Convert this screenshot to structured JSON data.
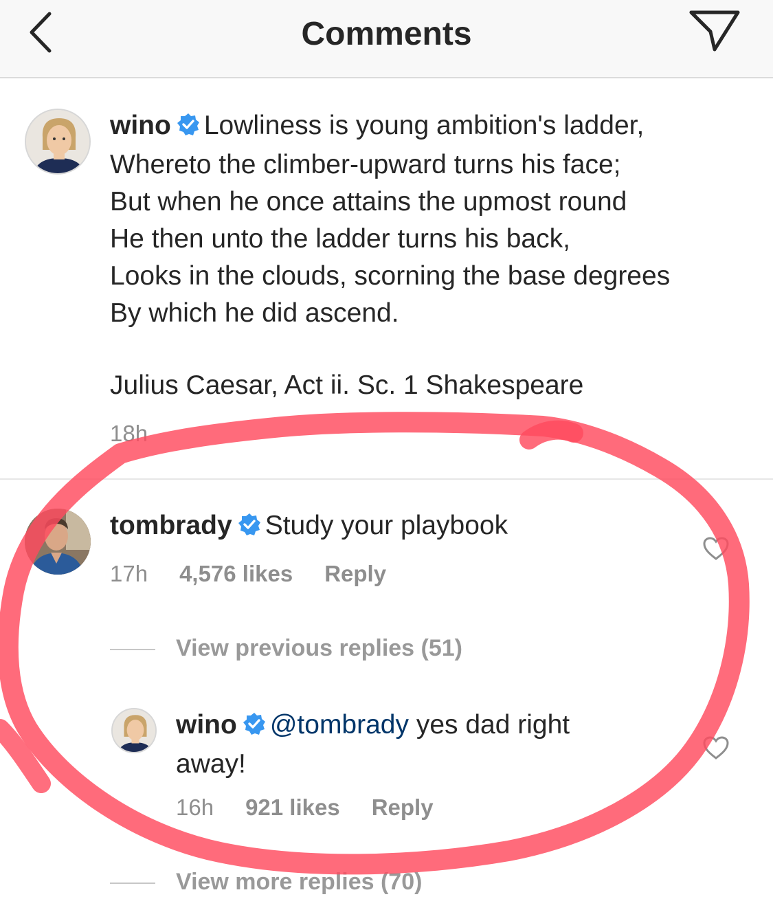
{
  "header": {
    "title": "Comments"
  },
  "caption": {
    "username": "wino",
    "lines": [
      "Lowliness is young ambition's ladder,",
      "Whereto the climber-upward turns his face;",
      "But when he once attains the upmost round",
      "He then unto the ladder turns his back,",
      "Looks in the clouds, scorning the base degrees",
      "By which he did ascend."
    ],
    "attribution": "Julius Caesar, Act ii. Sc. 1 Shakespeare",
    "time": "18h"
  },
  "comment": {
    "username": "tombrady",
    "text": "Study your playbook",
    "time": "17h",
    "likes": "4,576 likes",
    "reply_label": "Reply"
  },
  "view_previous": "View previous replies (51)",
  "reply": {
    "username": "wino",
    "mention": "@tombrady",
    "text_line1": " yes dad right",
    "text_line2": "away!",
    "time": "16h",
    "likes": "921 likes",
    "reply_label": "Reply"
  },
  "view_more": "View more replies (70)",
  "colors": {
    "verified": "#3897f0",
    "mention": "#003569",
    "annotation": "#ff4a5e"
  },
  "icons": [
    "back-chevron-icon",
    "send-icon",
    "verified-badge-icon",
    "heart-icon"
  ]
}
